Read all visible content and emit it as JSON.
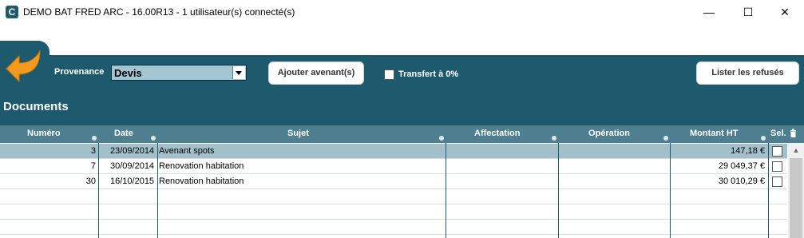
{
  "window": {
    "title": "DEMO BAT FRED ARC - 16.00R13 - 1 utilisateur(s) connecté(s)",
    "app_icon": "C",
    "controls": {
      "minimize": "—",
      "maximize": "☐",
      "close": "✕"
    }
  },
  "toolbar": {
    "provenance_label": "Provenance",
    "provenance_value": "Devis",
    "add_amendment_button": "Ajouter avenant(s)",
    "transfer_label": "Transfert à 0%",
    "list_refused_button": "Lister les refusés"
  },
  "documents": {
    "section_title": "Documents",
    "columns": [
      "Numéro",
      "Date",
      "Sujet",
      "Affectation",
      "Opération",
      "Montant HT",
      "Sel."
    ],
    "rows": [
      {
        "numero": "3",
        "date": "23/09/2014",
        "sujet": "Avenant spots",
        "affectation": "",
        "operation": "",
        "montant": "147,18 €"
      },
      {
        "numero": "7",
        "date": "30/09/2014",
        "sujet": "Renovation habitation",
        "affectation": "",
        "operation": "",
        "montant": "29 049,37 €"
      },
      {
        "numero": "30",
        "date": "16/10/2015",
        "sujet": "Renovation habitation",
        "affectation": "",
        "operation": "",
        "montant": "30 010,29 €"
      }
    ]
  },
  "scrollbar": {
    "up_arrow": "▲"
  },
  "colors": {
    "header_bg": "#1e5a6e",
    "column_header_bg": "#4e7f91",
    "selected_row_bg": "#a2bfca",
    "accent_orange": "#f39a1d"
  }
}
